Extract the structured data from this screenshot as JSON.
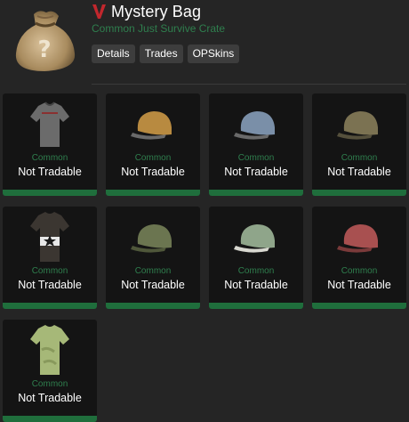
{
  "header": {
    "title": "Mystery Bag",
    "subtitle": "Common Just Survive Crate",
    "buttons": [
      "Details",
      "Trades",
      "OPSkins"
    ],
    "brand_color": "#c1272d",
    "rarity_color": "#2f7f4e"
  },
  "items": [
    {
      "kind": "shirt-icon",
      "rarity": "Common",
      "status": "Not Tradable"
    },
    {
      "kind": "cap-icon",
      "rarity": "Common",
      "status": "Not Tradable"
    },
    {
      "kind": "cap-icon",
      "rarity": "Common",
      "status": "Not Tradable"
    },
    {
      "kind": "cap-icon",
      "rarity": "Common",
      "status": "Not Tradable"
    },
    {
      "kind": "shirt-icon",
      "rarity": "Common",
      "status": "Not Tradable"
    },
    {
      "kind": "cap-icon",
      "rarity": "Common",
      "status": "Not Tradable"
    },
    {
      "kind": "cap-icon",
      "rarity": "Common",
      "status": "Not Tradable"
    },
    {
      "kind": "cap-icon",
      "rarity": "Common",
      "status": "Not Tradable"
    },
    {
      "kind": "shirt-icon",
      "rarity": "Common",
      "status": "Not Tradable"
    }
  ]
}
